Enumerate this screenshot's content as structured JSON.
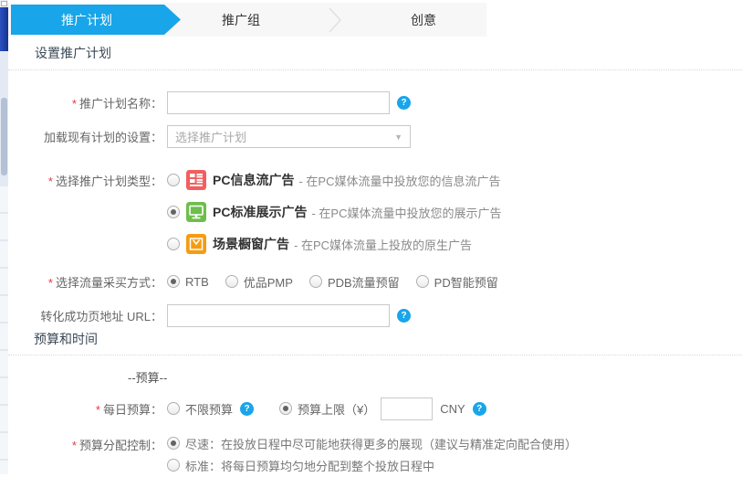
{
  "ui": {
    "required_mark": "*",
    "help_glyph": "?",
    "caret_glyph": "▼",
    "accent_blue": "#18a5e9",
    "icon_colors": {
      "feed": "#f15f5f",
      "monitor": "#6dbe4c",
      "showcase": "#f49c12"
    }
  },
  "wizard": {
    "steps": [
      {
        "label": "推广计划",
        "active": true
      },
      {
        "label": "推广组",
        "active": false
      },
      {
        "label": "创意",
        "active": false
      }
    ]
  },
  "sections": {
    "setup": "设置推广计划",
    "budget_time": "预算和时间",
    "budget_group": "--预算--"
  },
  "form": {
    "plan_name": {
      "label": "推广计划名称：",
      "value": ""
    },
    "load_existing": {
      "label": "加载现有计划的设置：",
      "selected_option": "选择推广计划"
    },
    "plan_type": {
      "label": "选择推广计划类型：",
      "options": [
        {
          "name": "PC信息流广告",
          "desc": "- 在PC媒体流量中投放您的信息流广告",
          "icon": "feed-icon",
          "selected": false
        },
        {
          "name": "PC标准展示广告",
          "desc": "- 在PC媒体流量中投放您的展示广告",
          "icon": "monitor-icon",
          "selected": true
        },
        {
          "name": "场景橱窗广告",
          "desc": "- 在PC媒体流量上投放的原生广告",
          "icon": "showcase-icon",
          "selected": false
        }
      ]
    },
    "buy_method": {
      "label": "选择流量采买方式：",
      "options": [
        {
          "name": "RTB",
          "selected": true
        },
        {
          "name": "优品PMP",
          "selected": false
        },
        {
          "name": "PDB流量预留",
          "selected": false
        },
        {
          "name": "PD智能预留",
          "selected": false
        }
      ]
    },
    "conv_url": {
      "label": "转化成功页地址 URL：",
      "value": ""
    },
    "daily_budget": {
      "label": "每日预算：",
      "unlimited": "不限预算",
      "unlimited_selected": false,
      "cap": "预算上限（¥）",
      "cap_selected": true,
      "cap_value": "",
      "currency": "CNY"
    },
    "allocation": {
      "label": "预算分配控制：",
      "options": [
        {
          "text": "尽速：在投放日程中尽可能地获得更多的展现（建议与精准定向配合使用）",
          "selected": true
        },
        {
          "text": "标准：将每日预算均匀地分配到整个投放日程中",
          "selected": false
        }
      ]
    }
  }
}
